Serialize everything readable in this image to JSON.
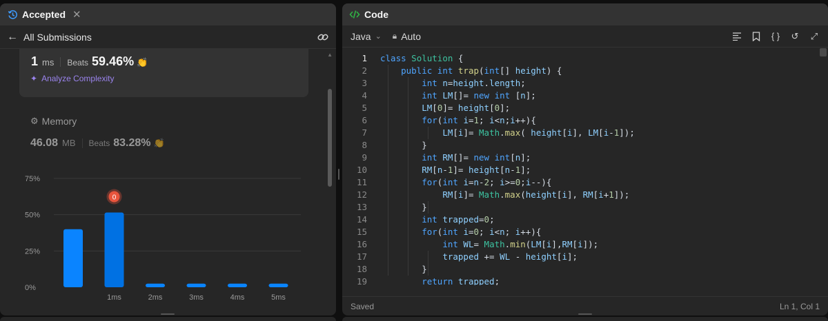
{
  "left": {
    "tab_title": "Accepted",
    "close_icon": "close-icon",
    "back_label": "All Submissions",
    "runtime": {
      "value": "1",
      "unit": "ms",
      "beats_label": "Beats",
      "beats_value": "59.46%"
    },
    "analyze_label": "Analyze Complexity",
    "memory": {
      "title": "Memory",
      "value": "46.08",
      "unit": "MB",
      "beats_label": "Beats",
      "beats_value": "83.28%"
    }
  },
  "chart_data": {
    "type": "bar",
    "categories": [
      "",
      "1ms",
      "2ms",
      "3ms",
      "4ms",
      "5ms"
    ],
    "values": [
      40,
      51.5,
      2.5,
      2.5,
      2.5,
      2.5
    ],
    "highlight_index": 1,
    "marker_label": "0",
    "yticks": [
      "0%",
      "25%",
      "50%",
      "75%"
    ],
    "ylim": [
      0,
      75
    ],
    "colors": {
      "bar": "#0a84ff",
      "highlight": "#0071e3",
      "marker": "#e8543c",
      "grid": "#3a3a3a"
    }
  },
  "right": {
    "tab_title": "Code",
    "language": "Java",
    "mode": "Auto",
    "status_left": "Saved",
    "status_right": "Ln 1, Col 1",
    "code_lines": [
      [
        [
          "kw",
          "class"
        ],
        [
          "t",
          " "
        ],
        [
          "type",
          "Solution"
        ],
        [
          "t",
          " {"
        ]
      ],
      [
        [
          "t",
          "    "
        ],
        [
          "kw",
          "public"
        ],
        [
          "t",
          " "
        ],
        [
          "kw",
          "int"
        ],
        [
          "t",
          " "
        ],
        [
          "fn",
          "trap"
        ],
        [
          "t",
          "("
        ],
        [
          "kw",
          "int"
        ],
        [
          "t",
          "[] "
        ],
        [
          "var",
          "height"
        ],
        [
          "t",
          ") {"
        ]
      ],
      [
        [
          "t",
          "        "
        ],
        [
          "kw",
          "int"
        ],
        [
          "t",
          " "
        ],
        [
          "var",
          "n"
        ],
        [
          "t",
          "="
        ],
        [
          "var",
          "height"
        ],
        [
          "t",
          "."
        ],
        [
          "var",
          "length"
        ],
        [
          "t",
          ";"
        ]
      ],
      [
        [
          "t",
          "        "
        ],
        [
          "kw",
          "int"
        ],
        [
          "t",
          " "
        ],
        [
          "var",
          "LM"
        ],
        [
          "t",
          "[]= "
        ],
        [
          "kw",
          "new"
        ],
        [
          "t",
          " "
        ],
        [
          "kw",
          "int"
        ],
        [
          "t",
          " ["
        ],
        [
          "var",
          "n"
        ],
        [
          "t",
          "];"
        ]
      ],
      [
        [
          "t",
          "        "
        ],
        [
          "var",
          "LM"
        ],
        [
          "t",
          "["
        ],
        [
          "num",
          "0"
        ],
        [
          "t",
          "]= "
        ],
        [
          "var",
          "height"
        ],
        [
          "t",
          "["
        ],
        [
          "num",
          "0"
        ],
        [
          "t",
          "];"
        ]
      ],
      [
        [
          "t",
          "        "
        ],
        [
          "kw",
          "for"
        ],
        [
          "t",
          "("
        ],
        [
          "kw",
          "int"
        ],
        [
          "t",
          " "
        ],
        [
          "var",
          "i"
        ],
        [
          "t",
          "="
        ],
        [
          "num",
          "1"
        ],
        [
          "t",
          "; "
        ],
        [
          "var",
          "i"
        ],
        [
          "t",
          "<"
        ],
        [
          "var",
          "n"
        ],
        [
          "t",
          ";"
        ],
        [
          "var",
          "i"
        ],
        [
          "t",
          "++){"
        ]
      ],
      [
        [
          "t",
          "            "
        ],
        [
          "var",
          "LM"
        ],
        [
          "t",
          "["
        ],
        [
          "var",
          "i"
        ],
        [
          "t",
          "]= "
        ],
        [
          "type",
          "Math"
        ],
        [
          "t",
          "."
        ],
        [
          "fn",
          "max"
        ],
        [
          "t",
          "( "
        ],
        [
          "var",
          "height"
        ],
        [
          "t",
          "["
        ],
        [
          "var",
          "i"
        ],
        [
          "t",
          "], "
        ],
        [
          "var",
          "LM"
        ],
        [
          "t",
          "["
        ],
        [
          "var",
          "i"
        ],
        [
          "t",
          "-"
        ],
        [
          "num",
          "1"
        ],
        [
          "t",
          "]);"
        ]
      ],
      [
        [
          "t",
          "        }"
        ]
      ],
      [
        [
          "t",
          "        "
        ],
        [
          "kw",
          "int"
        ],
        [
          "t",
          " "
        ],
        [
          "var",
          "RM"
        ],
        [
          "t",
          "[]= "
        ],
        [
          "kw",
          "new"
        ],
        [
          "t",
          " "
        ],
        [
          "kw",
          "int"
        ],
        [
          "t",
          "["
        ],
        [
          "var",
          "n"
        ],
        [
          "t",
          "];"
        ]
      ],
      [
        [
          "t",
          "        "
        ],
        [
          "var",
          "RM"
        ],
        [
          "t",
          "["
        ],
        [
          "var",
          "n"
        ],
        [
          "t",
          "-"
        ],
        [
          "num",
          "1"
        ],
        [
          "t",
          "]= "
        ],
        [
          "var",
          "height"
        ],
        [
          "t",
          "["
        ],
        [
          "var",
          "n"
        ],
        [
          "t",
          "-"
        ],
        [
          "num",
          "1"
        ],
        [
          "t",
          "];"
        ]
      ],
      [
        [
          "t",
          "        "
        ],
        [
          "kw",
          "for"
        ],
        [
          "t",
          "("
        ],
        [
          "kw",
          "int"
        ],
        [
          "t",
          " "
        ],
        [
          "var",
          "i"
        ],
        [
          "t",
          "="
        ],
        [
          "var",
          "n"
        ],
        [
          "t",
          "-"
        ],
        [
          "num",
          "2"
        ],
        [
          "t",
          "; "
        ],
        [
          "var",
          "i"
        ],
        [
          "t",
          ">="
        ],
        [
          "num",
          "0"
        ],
        [
          "t",
          ";"
        ],
        [
          "var",
          "i"
        ],
        [
          "t",
          "--){"
        ]
      ],
      [
        [
          "t",
          "            "
        ],
        [
          "var",
          "RM"
        ],
        [
          "t",
          "["
        ],
        [
          "var",
          "i"
        ],
        [
          "t",
          "]= "
        ],
        [
          "type",
          "Math"
        ],
        [
          "t",
          "."
        ],
        [
          "fn",
          "max"
        ],
        [
          "t",
          "("
        ],
        [
          "var",
          "height"
        ],
        [
          "t",
          "["
        ],
        [
          "var",
          "i"
        ],
        [
          "t",
          "], "
        ],
        [
          "var",
          "RM"
        ],
        [
          "t",
          "["
        ],
        [
          "var",
          "i"
        ],
        [
          "t",
          "+"
        ],
        [
          "num",
          "1"
        ],
        [
          "t",
          "]);"
        ]
      ],
      [
        [
          "t",
          "        }"
        ]
      ],
      [
        [
          "t",
          "        "
        ],
        [
          "kw",
          "int"
        ],
        [
          "t",
          " "
        ],
        [
          "var",
          "trapped"
        ],
        [
          "t",
          "="
        ],
        [
          "num",
          "0"
        ],
        [
          "t",
          ";"
        ]
      ],
      [
        [
          "t",
          "        "
        ],
        [
          "kw",
          "for"
        ],
        [
          "t",
          "("
        ],
        [
          "kw",
          "int"
        ],
        [
          "t",
          " "
        ],
        [
          "var",
          "i"
        ],
        [
          "t",
          "="
        ],
        [
          "num",
          "0"
        ],
        [
          "t",
          "; "
        ],
        [
          "var",
          "i"
        ],
        [
          "t",
          "<"
        ],
        [
          "var",
          "n"
        ],
        [
          "t",
          "; "
        ],
        [
          "var",
          "i"
        ],
        [
          "t",
          "++){"
        ]
      ],
      [
        [
          "t",
          "            "
        ],
        [
          "kw",
          "int"
        ],
        [
          "t",
          " "
        ],
        [
          "var",
          "WL"
        ],
        [
          "t",
          "= "
        ],
        [
          "type",
          "Math"
        ],
        [
          "t",
          "."
        ],
        [
          "fn",
          "min"
        ],
        [
          "t",
          "("
        ],
        [
          "var",
          "LM"
        ],
        [
          "t",
          "["
        ],
        [
          "var",
          "i"
        ],
        [
          "t",
          "],"
        ],
        [
          "var",
          "RM"
        ],
        [
          "t",
          "["
        ],
        [
          "var",
          "i"
        ],
        [
          "t",
          "]);"
        ]
      ],
      [
        [
          "t",
          "            "
        ],
        [
          "var",
          "trapped"
        ],
        [
          "t",
          " += "
        ],
        [
          "var",
          "WL"
        ],
        [
          "t",
          " - "
        ],
        [
          "var",
          "height"
        ],
        [
          "t",
          "["
        ],
        [
          "var",
          "i"
        ],
        [
          "t",
          "];"
        ]
      ],
      [
        [
          "t",
          "        }"
        ]
      ],
      [
        [
          "t",
          "        "
        ],
        [
          "kw",
          "return"
        ],
        [
          "t",
          " "
        ],
        [
          "var",
          "trapped"
        ],
        [
          "t",
          ";"
        ]
      ]
    ]
  }
}
